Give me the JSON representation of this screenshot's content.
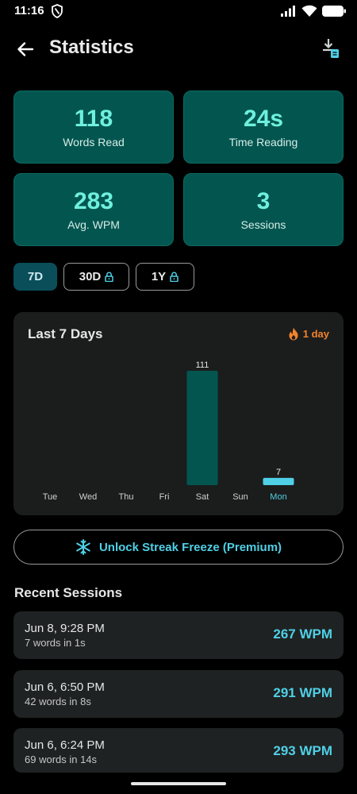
{
  "status_bar": {
    "time": "11:16"
  },
  "header": {
    "title": "Statistics"
  },
  "stats": [
    {
      "value": "118",
      "label": "Words Read"
    },
    {
      "value": "24s",
      "label": "Time Reading"
    },
    {
      "value": "283",
      "label": "Avg. WPM"
    },
    {
      "value": "3",
      "label": "Sessions"
    }
  ],
  "ranges": [
    {
      "label": "7D",
      "locked": false,
      "selected": true
    },
    {
      "label": "30D",
      "locked": true,
      "selected": false
    },
    {
      "label": "1Y",
      "locked": true,
      "selected": false
    }
  ],
  "chart_card": {
    "title": "Last 7 Days",
    "streak": "1 day"
  },
  "chart_data": {
    "type": "bar",
    "title": "Last 7 Days",
    "categories": [
      "Tue",
      "Wed",
      "Thu",
      "Fri",
      "Sat",
      "Sun",
      "Mon"
    ],
    "values": [
      0,
      0,
      0,
      0,
      111,
      0,
      7
    ],
    "data_labels": [
      "",
      "",
      "",
      "",
      "111",
      "",
      "7"
    ],
    "highlighted_category": "Mon",
    "ylim": [
      0,
      111
    ],
    "grid": false,
    "colors": {
      "bar": "#03564f",
      "highlight": "#4fd0e6",
      "label": "#e6e6e6"
    }
  },
  "freeze_button": {
    "label": "Unlock Streak Freeze (Premium)",
    "icon": "snowflake-icon"
  },
  "recent": {
    "title": "Recent Sessions",
    "sessions": [
      {
        "date": "Jun 8, 9:28 PM",
        "detail": "7 words in 1s",
        "wpm": "267 WPM"
      },
      {
        "date": "Jun 6, 6:50 PM",
        "detail": "42 words in 8s",
        "wpm": "291 WPM"
      },
      {
        "date": "Jun 6, 6:24 PM",
        "detail": "69 words in 14s",
        "wpm": "293 WPM"
      }
    ]
  },
  "colors": {
    "accent": "#4fd0e6",
    "card": "#03564f",
    "streak": "#f5832a"
  }
}
